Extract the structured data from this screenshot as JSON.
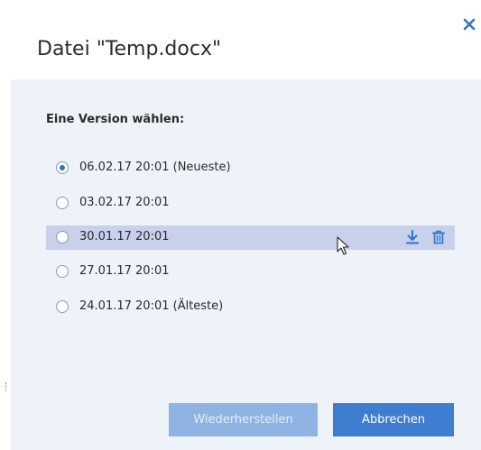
{
  "dialog": {
    "title": "Datei \"Temp.docx\"",
    "close_icon": "close-icon",
    "section_label": "Eine Version wählen:",
    "versions": [
      {
        "label": "06.02.17 20:01 (Neueste)",
        "selected": true
      },
      {
        "label": "03.02.17 20:01",
        "selected": false
      },
      {
        "label": "30.01.17 20:01",
        "selected": false,
        "hovered": true
      },
      {
        "label": "27.01.17 20:01",
        "selected": false
      },
      {
        "label": "24.01.17 20:01 (Älteste)",
        "selected": false
      }
    ],
    "row_actions": {
      "download_icon": "download-icon",
      "delete_icon": "trash-icon"
    },
    "buttons": {
      "restore": "Wiederherstellen",
      "restore_enabled": false,
      "cancel": "Abbrechen"
    },
    "colors": {
      "accent": "#3f7dd1",
      "accent_disabled": "#8fb4e3",
      "hover_row": "#c8d0eb",
      "body_bg": "#eef3fa"
    }
  }
}
